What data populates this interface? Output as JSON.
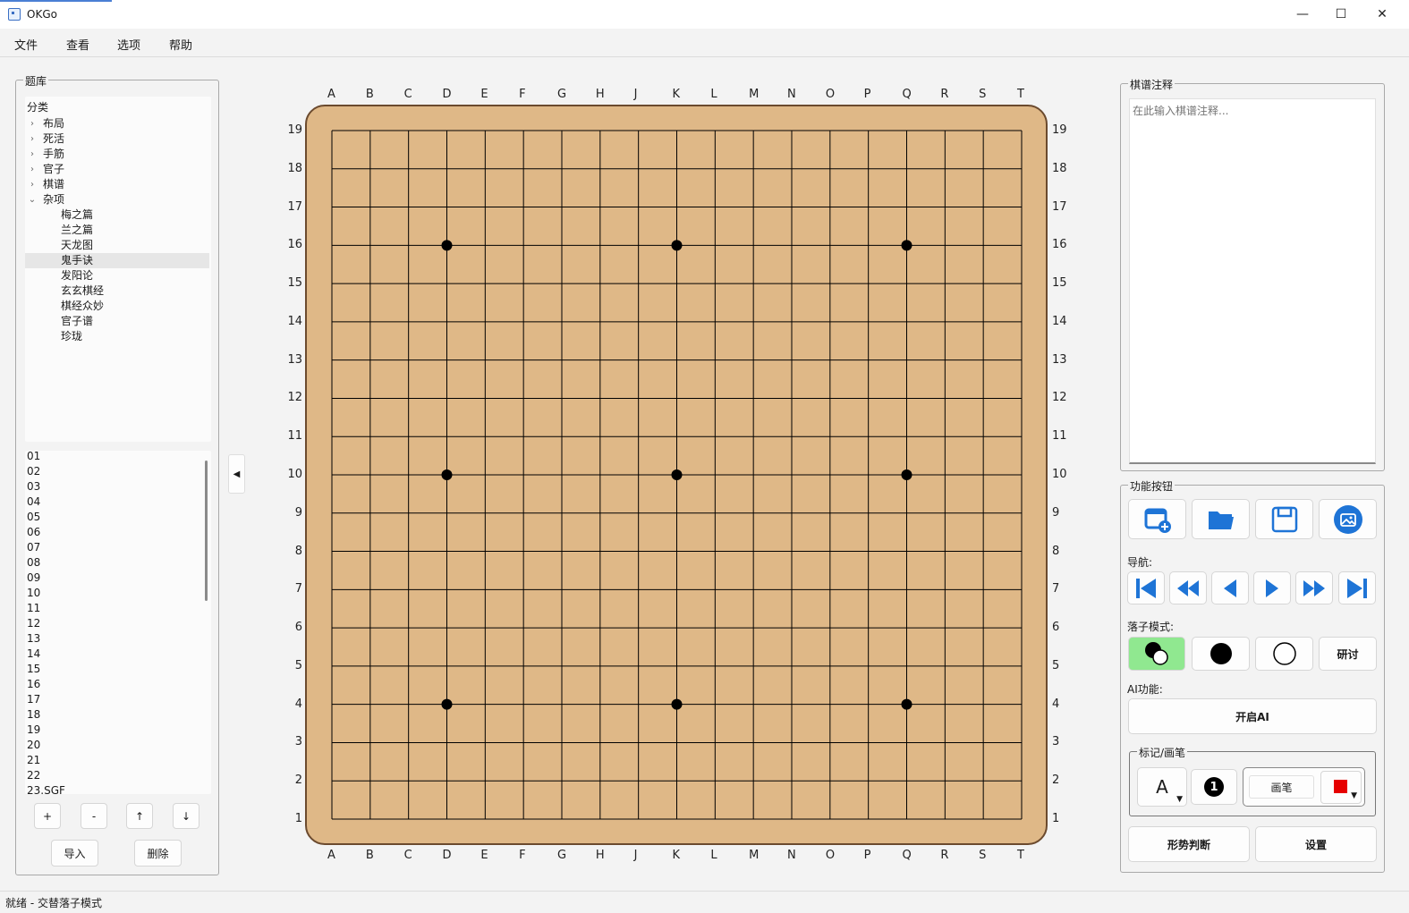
{
  "window": {
    "title": "OKGo",
    "minimize_glyph": "—",
    "maximize_glyph": "☐",
    "close_glyph": "✕"
  },
  "menu": [
    "文件",
    "查看",
    "选项",
    "帮助"
  ],
  "library": {
    "title": "题库",
    "tree_header": "分类",
    "categories": [
      {
        "label": "布局",
        "expanded": false
      },
      {
        "label": "死活",
        "expanded": false
      },
      {
        "label": "手筋",
        "expanded": false
      },
      {
        "label": "官子",
        "expanded": false
      },
      {
        "label": "棋谱",
        "expanded": false
      },
      {
        "label": "杂项",
        "expanded": true
      }
    ],
    "subitems": [
      "梅之篇",
      "兰之篇",
      "天龙图",
      "鬼手诀",
      "发阳论",
      "玄玄棋经",
      "棋经众妙",
      "官子谱",
      "珍珑"
    ],
    "selected_subitem": "鬼手诀",
    "files": [
      "01",
      "02",
      "03",
      "04",
      "05",
      "06",
      "07",
      "08",
      "09",
      "10",
      "11",
      "12",
      "13",
      "14",
      "15",
      "16",
      "17",
      "18",
      "19",
      "20",
      "21",
      "22",
      "23.SGF"
    ],
    "buttons": {
      "add": "+",
      "remove": "-",
      "up": "↑",
      "down": "↓",
      "import": "导入",
      "delete": "删除"
    }
  },
  "board": {
    "size": 19,
    "columns": [
      "A",
      "B",
      "C",
      "D",
      "E",
      "F",
      "G",
      "H",
      "J",
      "K",
      "L",
      "M",
      "N",
      "O",
      "P",
      "Q",
      "R",
      "S",
      "T"
    ],
    "rows": [
      "19",
      "18",
      "17",
      "16",
      "15",
      "14",
      "13",
      "12",
      "11",
      "10",
      "9",
      "8",
      "7",
      "6",
      "5",
      "4",
      "3",
      "2",
      "1"
    ],
    "star_points": [
      "D16",
      "K16",
      "Q16",
      "D10",
      "K10",
      "Q10",
      "D4",
      "K4",
      "Q4"
    ],
    "colors": {
      "wood": "#dfb887",
      "border": "#6b4a2e",
      "line": "#000000"
    }
  },
  "collapse_glyph": "◀",
  "notes": {
    "title": "棋谱注释",
    "placeholder": "在此输入棋谱注释..."
  },
  "functions": {
    "title": "功能按钮",
    "file_icons": [
      "new-game-icon",
      "open-folder-icon",
      "save-icon",
      "image-export-icon"
    ],
    "nav_label": "导航:",
    "nav_icons": [
      "first-move-icon",
      "fast-back-icon",
      "back-icon",
      "forward-icon",
      "fast-forward-icon",
      "last-move-icon"
    ],
    "mode_label": "落子模式:",
    "discuss_label": "研讨",
    "ai_label": "AI功能:",
    "ai_button": "开启AI",
    "mark_title": "标记/画笔",
    "mark_letter": "A",
    "mark_number": "1",
    "brush_label": "画笔",
    "brush_color": "#e60000",
    "assess_button": "形势判断",
    "settings_button": "设置"
  },
  "accent": {
    "blue": "#1e74d6",
    "active_mode": "#90e890"
  },
  "status": "就绪 - 交替落子模式"
}
